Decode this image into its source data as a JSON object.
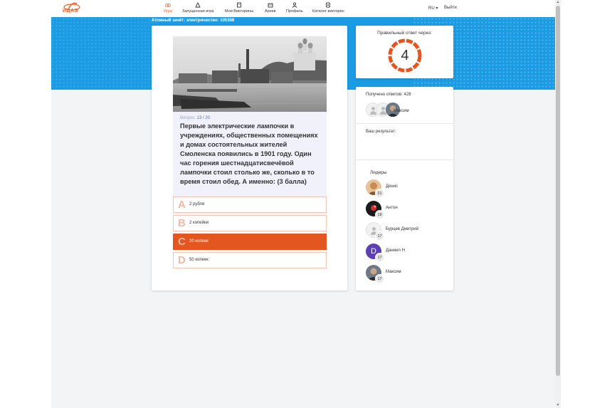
{
  "header": {
    "logo_text": "ИЦАЭ",
    "nav": [
      {
        "label": "Игра",
        "icon": "game-icon",
        "active": true
      },
      {
        "label": "Запущенная игра",
        "icon": "running-game-icon"
      },
      {
        "label": "Мои Викторины",
        "icon": "my-quizzes-icon"
      },
      {
        "label": "Архив",
        "icon": "archive-icon"
      },
      {
        "label": "Профиль",
        "icon": "profile-icon"
      },
      {
        "label": "Каталог викторин",
        "icon": "catalog-icon"
      }
    ],
    "lang": "RU ▾",
    "logout": "Выйти"
  },
  "tournament": "Атомный зачёт: электричество: 105388",
  "question": {
    "counter_label": "Вопрос:",
    "counter_value": "13 / 20",
    "text": "Первые электрические лампочки в учреждениях, общественных помещениях и домах состоятельных жителей Смоленска появились в 1901 году. Один час горения шестнадцатисвечёвой лампочки стоил столько же, сколько в то время стоил обед. А именно: (3 балла)",
    "answers": [
      {
        "letter": "A",
        "text": "2 рубля",
        "selected": false
      },
      {
        "letter": "B",
        "text": "2 копейки",
        "selected": false
      },
      {
        "letter": "C",
        "text": "20 копеек",
        "selected": true
      },
      {
        "letter": "D",
        "text": "50 копеек",
        "selected": false
      }
    ]
  },
  "timer": {
    "label": "Правильный ответ через:",
    "seconds": "4",
    "ring_color": "#e4561f"
  },
  "sidebar": {
    "answers_received": "Получено ответов: 428",
    "player_name": "Максим",
    "result_label": "Ваш результат:",
    "leaders_label": "Лидеры",
    "leaders": [
      {
        "name": "Денис",
        "score": "21"
      },
      {
        "name": "Антон",
        "score": "19"
      },
      {
        "name": "Бурцев Дмитрий",
        "score": "17"
      },
      {
        "name": "Даниил Н",
        "score": "17",
        "initial": "D"
      },
      {
        "name": "Максим",
        "score": "17"
      }
    ]
  },
  "colors": {
    "accent": "#e4561f",
    "brand_blue": "#1a9be3"
  }
}
